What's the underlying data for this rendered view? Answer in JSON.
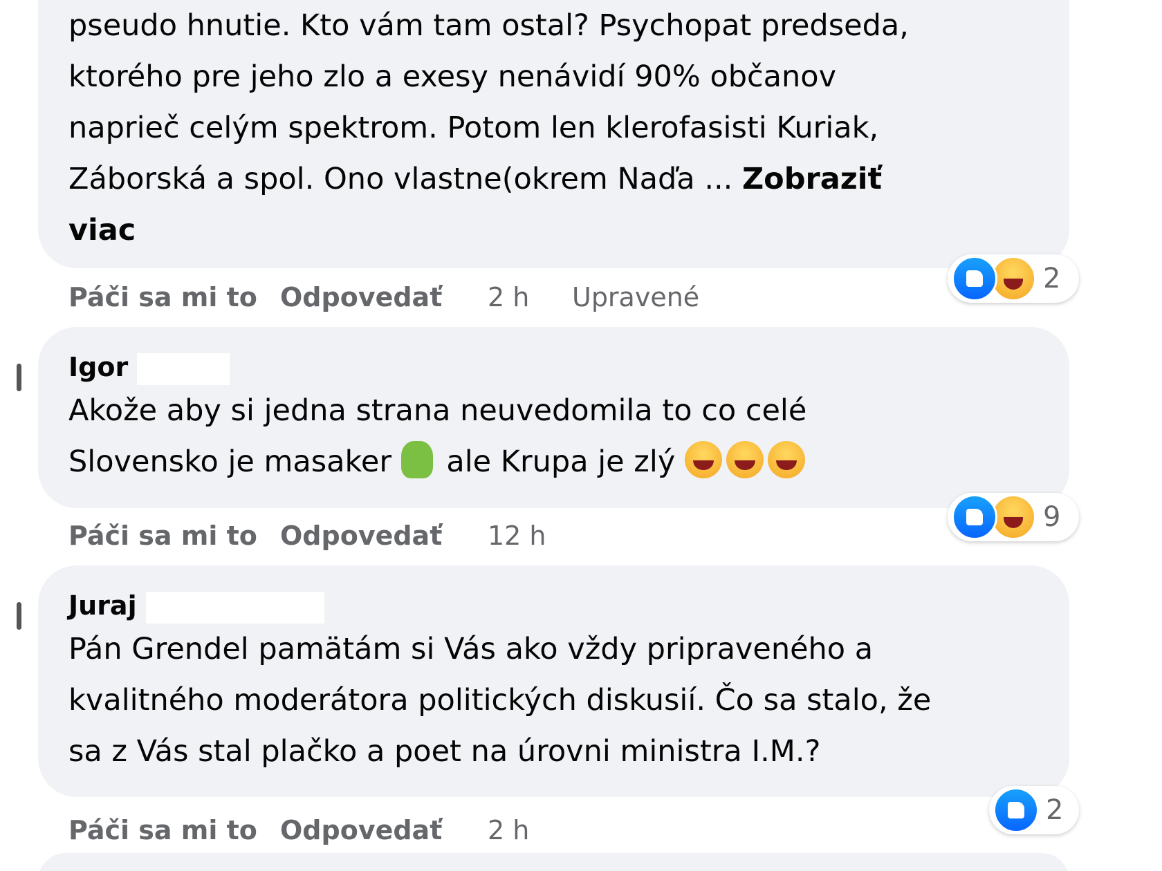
{
  "comments": [
    {
      "author": "",
      "text_lines": [
        "pseudo hnutie. Kto vám tam ostal? Psychopat predseda,",
        "ktorého pre jeho zlo a exesy nenávidí 90% občanov",
        "naprieč celým spektrom. Potom len klerofasisti Kuriak,",
        "Záborská a spol. Ono vlastne(okrem Naďa ... "
      ],
      "see_more": "Zobraziť",
      "see_more_tail": "viac",
      "like_label": "Páči sa mi to",
      "reply_label": "Odpovedať",
      "time": "2 h",
      "edited": "Upravené",
      "reactions": [
        "like-icon",
        "haha-icon"
      ],
      "reaction_count": "2"
    },
    {
      "author": "Igor",
      "text_lines": [
        "Akože aby si jedna strana neuvedomila to co celé",
        "Slovensko je masaker",
        "ale Krupa je zlý"
      ],
      "like_label": "Páči sa mi to",
      "reply_label": "Odpovedať",
      "time": "12 h",
      "reactions": [
        "like-icon",
        "haha-icon"
      ],
      "reaction_count": "9"
    },
    {
      "author": "Juraj",
      "text_lines": [
        "Pán Grendel pamätám si Vás ako vždy pripraveného a",
        "kvalitného moderátora politických diskusií. Čo sa stalo, že",
        "sa z Vás stal plačko a poet na úrovni ministra I.M.?"
      ],
      "like_label": "Páči sa mi to",
      "reply_label": "Odpovedať",
      "time": "2 h",
      "reactions": [
        "like-icon"
      ],
      "reaction_count": "2"
    }
  ],
  "colors": {
    "bubble": "#f0f2f5",
    "secondary_text": "#65676b",
    "like_blue": "#0866ff"
  }
}
